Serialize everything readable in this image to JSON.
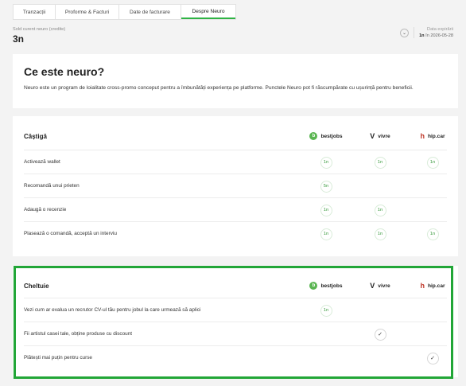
{
  "tabs": [
    {
      "label": "Tranzacții"
    },
    {
      "label": "Proforme & Facturi"
    },
    {
      "label": "Date de facturare"
    },
    {
      "label": "Despre Neuro"
    }
  ],
  "balance": {
    "label": "Sold curent neuro (credite)",
    "value": "3n"
  },
  "expiry": {
    "label": "Data expirării",
    "amount": "1n",
    "date": "în 2026-05-28"
  },
  "intro": {
    "title": "Ce este neuro?",
    "text": "Neuro este un program de loialitate cross-promo conceput pentru a îmbunătăți experiența pe platforme. Punctele Neuro pot fi răscumpărate cu ușurință pentru beneficii."
  },
  "brands": {
    "bestjobs": "bestjobs",
    "vivre": "vivre",
    "hipcar": "hip.car"
  },
  "earn": {
    "title": "Câștigă",
    "rows": [
      {
        "label": "Activează wallet",
        "bestjobs": "1n",
        "vivre": "1n",
        "hipcar": "1n"
      },
      {
        "label": "Recomandă unui prieten",
        "bestjobs": "5n",
        "vivre": "",
        "hipcar": ""
      },
      {
        "label": "Adaugă o recenzie",
        "bestjobs": "1n",
        "vivre": "1n",
        "hipcar": ""
      },
      {
        "label": "Plasează o comandă, acceptă un interviu",
        "bestjobs": "1n",
        "vivre": "1n",
        "hipcar": "1n"
      }
    ]
  },
  "spend": {
    "title": "Cheltuie",
    "rows": [
      {
        "label": "Vezi cum ar evalua un recrutor CV-ul tău pentru jobul la care urmează să aplici",
        "bestjobs": "1n",
        "vivre": "",
        "hipcar": ""
      },
      {
        "label": "Fii artistul casei tale, obține produse cu discount",
        "bestjobs": "",
        "vivre": "✓",
        "hipcar": ""
      },
      {
        "label": "Plătești mai puțin pentru curse",
        "bestjobs": "",
        "vivre": "",
        "hipcar": "✓"
      }
    ]
  },
  "colors": {
    "accent": "#2fb344",
    "highlight": "#22a637"
  }
}
